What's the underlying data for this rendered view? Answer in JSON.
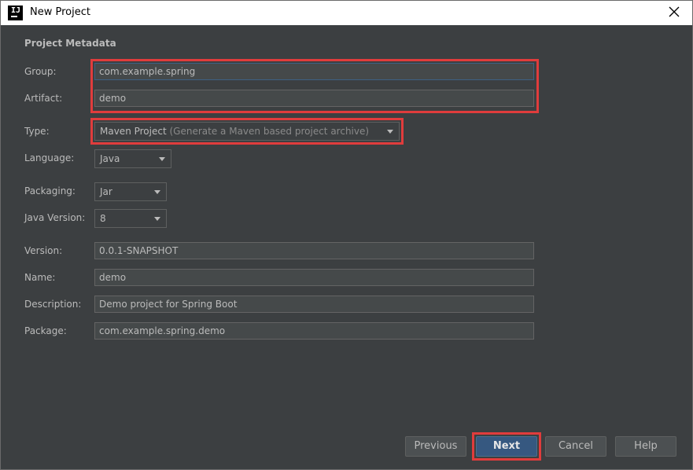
{
  "window": {
    "title": "New Project",
    "app_icon": "intellij-icon"
  },
  "section_title": "Project Metadata",
  "form": {
    "group": {
      "label": "Group:",
      "value": "com.example.spring"
    },
    "artifact": {
      "label": "Artifact:",
      "value": "demo"
    },
    "type": {
      "label": "Type:",
      "value": "Maven Project",
      "hint": "(Generate a Maven based project archive)"
    },
    "language": {
      "label": "Language:",
      "value": "Java"
    },
    "packaging": {
      "label": "Packaging:",
      "value": "Jar"
    },
    "java_version": {
      "label": "Java Version:",
      "value": "8"
    },
    "version": {
      "label": "Version:",
      "value": "0.0.1-SNAPSHOT"
    },
    "name": {
      "label": "Name:",
      "value": "demo"
    },
    "description": {
      "label": "Description:",
      "value": "Demo project for Spring Boot"
    },
    "package": {
      "label": "Package:",
      "value": "com.example.spring.demo"
    }
  },
  "buttons": {
    "previous": "Previous",
    "next": "Next",
    "cancel": "Cancel",
    "help": "Help"
  },
  "colors": {
    "background": "#3c3f41",
    "field_bg": "#45494a",
    "text": "#bbbbbb",
    "primary_button": "#365880",
    "highlight": "#e03c3c"
  }
}
